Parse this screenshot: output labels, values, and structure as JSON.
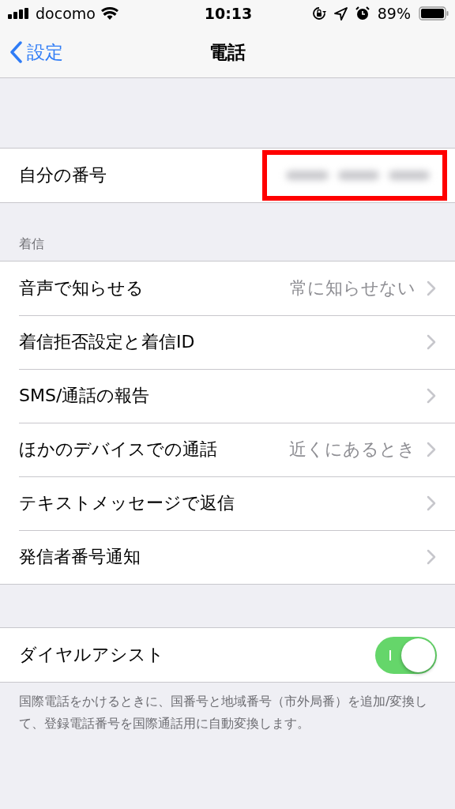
{
  "status_bar": {
    "carrier": "docomo",
    "time": "10:13",
    "battery": "89%"
  },
  "nav": {
    "back": "設定",
    "title": "電話"
  },
  "sections": [
    {
      "rows": [
        {
          "kind": "redacted",
          "label": "自分の番号",
          "highlighted": true
        }
      ]
    },
    {
      "header": "着信",
      "rows": [
        {
          "kind": "link",
          "label": "音声で知らせる",
          "value": "常に知らせない"
        },
        {
          "kind": "link",
          "label": "着信拒否設定と着信ID"
        },
        {
          "kind": "link",
          "label": "SMS/通話の報告"
        },
        {
          "kind": "link",
          "label": "ほかのデバイスでの通話",
          "value": "近くにあるとき"
        },
        {
          "kind": "link",
          "label": "テキストメッセージで返信"
        },
        {
          "kind": "link",
          "label": "発信者番号通知"
        }
      ]
    },
    {
      "rows": [
        {
          "kind": "toggle",
          "label": "ダイヤルアシスト",
          "on": true
        }
      ],
      "footer": "国際電話をかけるときに、国番号と地域番号（市外局番）を追加/変換して、登録電話番号を国際通話用に自動変換します。"
    }
  ]
}
